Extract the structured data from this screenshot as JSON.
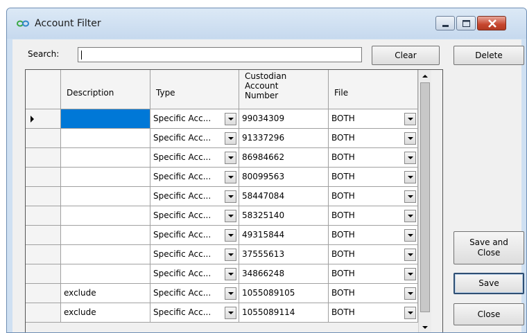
{
  "window": {
    "title": "Account Filter",
    "icon": "infinity-logo-icon",
    "accent_color": "#0078d7"
  },
  "search": {
    "label": "Search:",
    "value": "",
    "clear_label": "Clear"
  },
  "buttons": {
    "delete": "Delete",
    "save_and_close_line1": "Save and",
    "save_and_close_line2": "Close",
    "save": "Save",
    "close": "Close"
  },
  "grid": {
    "columns": [
      {
        "line1": "Description"
      },
      {
        "line1": "Type"
      },
      {
        "line1": "Custodian",
        "line2": "Account",
        "line3": "Number"
      },
      {
        "line1": "File"
      }
    ],
    "rows": [
      {
        "description": "",
        "type": "Specific Acc...",
        "account": "99034309",
        "file": "BOTH",
        "current": true,
        "selected": true
      },
      {
        "description": "",
        "type": "Specific Acc...",
        "account": "91337296",
        "file": "BOTH"
      },
      {
        "description": "",
        "type": "Specific Acc...",
        "account": "86984662",
        "file": "BOTH"
      },
      {
        "description": "",
        "type": "Specific Acc...",
        "account": "80099563",
        "file": "BOTH"
      },
      {
        "description": "",
        "type": "Specific Acc...",
        "account": "58447084",
        "file": "BOTH"
      },
      {
        "description": "",
        "type": "Specific Acc...",
        "account": "58325140",
        "file": "BOTH"
      },
      {
        "description": "",
        "type": "Specific Acc...",
        "account": "49315844",
        "file": "BOTH"
      },
      {
        "description": "",
        "type": "Specific Acc...",
        "account": "37555613",
        "file": "BOTH"
      },
      {
        "description": "",
        "type": "Specific Acc...",
        "account": "34866248",
        "file": "BOTH"
      },
      {
        "description": "exclude",
        "type": "Specific Acc...",
        "account": "1055089105",
        "file": "BOTH"
      },
      {
        "description": "exclude",
        "type": "Specific Acc...",
        "account": "1055089114",
        "file": "BOTH"
      }
    ]
  }
}
